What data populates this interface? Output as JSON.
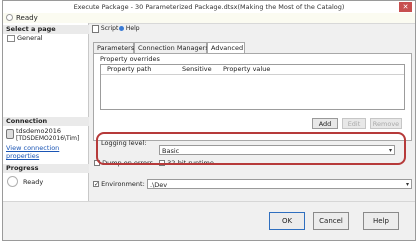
{
  "window": {
    "title": "Execute Package - 30 Parameterized Package.dtsx(Making the Most of the Catalog)",
    "close_glyph": "✕"
  },
  "status": {
    "text": "Ready"
  },
  "left_pane": {
    "select_page_header": "Select a page",
    "pages": [
      {
        "label": "General"
      }
    ],
    "connection_header": "Connection",
    "connection_server": "tdsdemo2016",
    "connection_user": "[TDSDEMO2016\\Tim]",
    "view_connection_properties": "View connection properties",
    "progress_header": "Progress",
    "progress_status": "Ready"
  },
  "toolbar": {
    "script_label": "Script",
    "script_arrow": "▾",
    "help_label": "Help"
  },
  "tabs": [
    {
      "label": "Parameters",
      "active": false
    },
    {
      "label": "Connection Managers",
      "active": false
    },
    {
      "label": "Advanced",
      "active": true
    }
  ],
  "advanced": {
    "property_overrides_label": "Property overrides",
    "columns": [
      "Property path",
      "Sensitive",
      "Property value"
    ],
    "rows": [],
    "add_label": "Add",
    "edit_label": "Edit",
    "remove_label": "Remove",
    "logging_level_label": "Logging level:",
    "logging_level_value": "Basic",
    "dump_on_errors_label": "Dump on errors",
    "dump_on_errors_checked": false,
    "runtime_32bit_label": "32-bit runtime",
    "runtime_32bit_checked": false
  },
  "environment": {
    "checked": true,
    "label": "Environment:",
    "value": ".\\Dev"
  },
  "footer": {
    "ok_label": "OK",
    "cancel_label": "Cancel",
    "help_label": "Help"
  },
  "colors": {
    "highlight_ring": "#b63a3a",
    "link": "#1a55b5",
    "close": "#c74f4f"
  }
}
